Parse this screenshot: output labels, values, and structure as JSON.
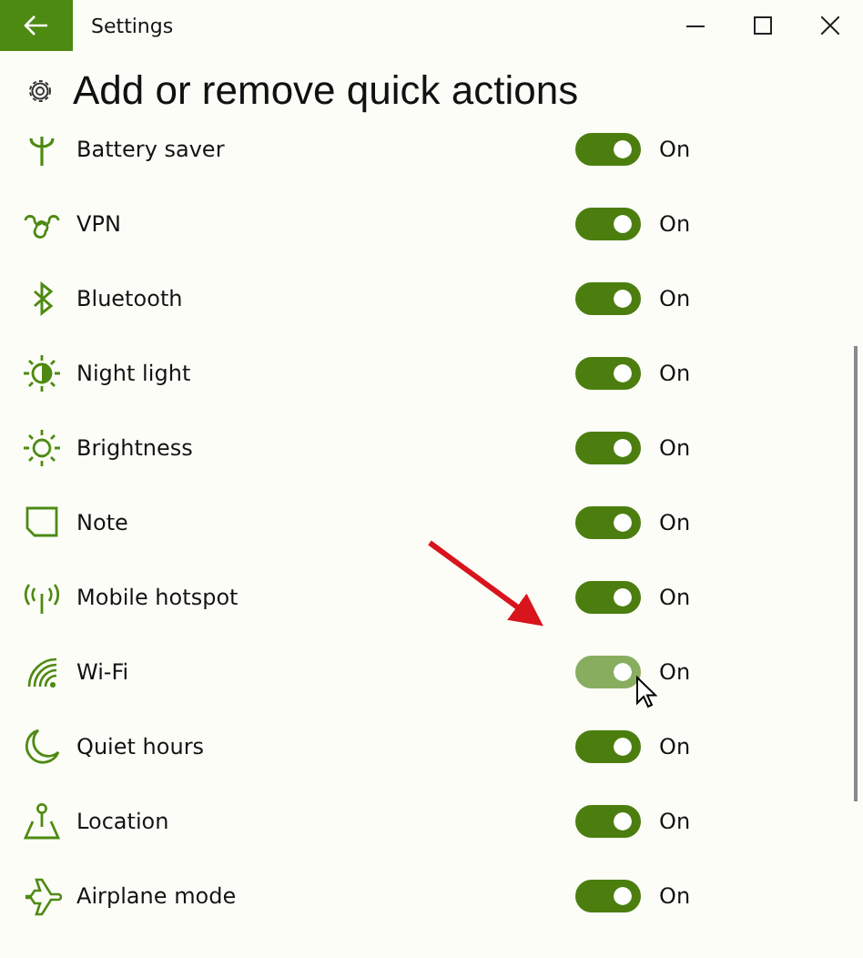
{
  "window": {
    "title": "Settings"
  },
  "page": {
    "heading": "Add or remove quick actions"
  },
  "actions": [
    {
      "label": "Battery saver",
      "on": true,
      "hovered": false,
      "state_text": "On"
    },
    {
      "label": "VPN",
      "on": true,
      "hovered": false,
      "state_text": "On"
    },
    {
      "label": "Bluetooth",
      "on": true,
      "hovered": false,
      "state_text": "On"
    },
    {
      "label": "Night light",
      "on": true,
      "hovered": false,
      "state_text": "On"
    },
    {
      "label": "Brightness",
      "on": true,
      "hovered": false,
      "state_text": "On"
    },
    {
      "label": "Note",
      "on": true,
      "hovered": false,
      "state_text": "On"
    },
    {
      "label": "Mobile hotspot",
      "on": true,
      "hovered": false,
      "state_text": "On"
    },
    {
      "label": "Wi-Fi",
      "on": true,
      "hovered": true,
      "state_text": "On"
    },
    {
      "label": "Quiet hours",
      "on": true,
      "hovered": false,
      "state_text": "On"
    },
    {
      "label": "Location",
      "on": true,
      "hovered": false,
      "state_text": "On"
    },
    {
      "label": "Airplane mode",
      "on": true,
      "hovered": false,
      "state_text": "On"
    }
  ]
}
